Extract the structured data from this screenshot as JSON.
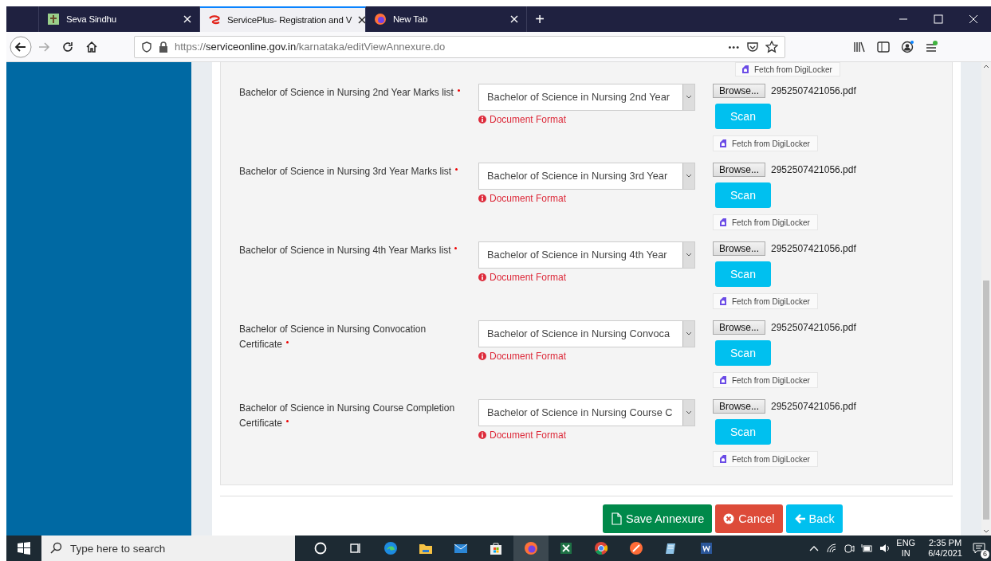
{
  "browser": {
    "tabs": [
      {
        "title": "Seva Sindhu",
        "selected": false
      },
      {
        "title": "ServicePlus- Registration and V",
        "selected": true
      },
      {
        "title": "New Tab",
        "selected": false
      }
    ],
    "new_tab": "+",
    "url": {
      "scheme": "https://",
      "host": "serviceonline.gov.in",
      "path": "/karnataka/editViewAnnexure.do"
    },
    "page_actions": "•••"
  },
  "form": {
    "leading_fetch": "Fetch from DigiLocker",
    "documents": [
      {
        "label": "Bachelor of Science in Nursing 2nd Year Marks list",
        "required": true,
        "selection": "Bachelor of Science in Nursing 2nd Year",
        "hint": "Document Format",
        "browse": "Browse...",
        "file": "2952507421056.pdf",
        "scan": "Scan",
        "fetch": "Fetch from DigiLocker"
      },
      {
        "label": "Bachelor of Science in Nursing 3rd Year Marks list",
        "required": true,
        "selection": "Bachelor of Science in Nursing 3rd Year",
        "hint": "Document Format",
        "browse": "Browse...",
        "file": "2952507421056.pdf",
        "scan": "Scan",
        "fetch": "Fetch from DigiLocker"
      },
      {
        "label": "Bachelor of Science in Nursing 4th Year Marks list",
        "required": true,
        "selection": "Bachelor of Science in Nursing 4th Year",
        "hint": "Document Format",
        "browse": "Browse...",
        "file": "2952507421056.pdf",
        "scan": "Scan",
        "fetch": "Fetch from DigiLocker"
      },
      {
        "label": "Bachelor of Science in Nursing Convocation Certificate",
        "required": true,
        "selection": "Bachelor of Science in Nursing Convoca",
        "hint": "Document Format",
        "browse": "Browse...",
        "file": "2952507421056.pdf",
        "scan": "Scan",
        "fetch": "Fetch from DigiLocker"
      },
      {
        "label": "Bachelor of Science in Nursing Course Completion Certificate",
        "required": true,
        "selection": "Bachelor of Science in Nursing Course C",
        "hint": "Document Format",
        "browse": "Browse...",
        "file": "2952507421056.pdf",
        "scan": "Scan",
        "fetch": "Fetch from DigiLocker"
      }
    ],
    "buttons": [
      {
        "label": "Save Annexure",
        "kind": "save"
      },
      {
        "label": "Cancel",
        "kind": "cancel"
      },
      {
        "label": "Back",
        "kind": "back"
      }
    ]
  },
  "taskbar": {
    "search_placeholder": "Type here to search",
    "language": "ENG",
    "region": "IN",
    "time": "2:35 PM",
    "date": "6/4/2021",
    "notifications": "6"
  }
}
